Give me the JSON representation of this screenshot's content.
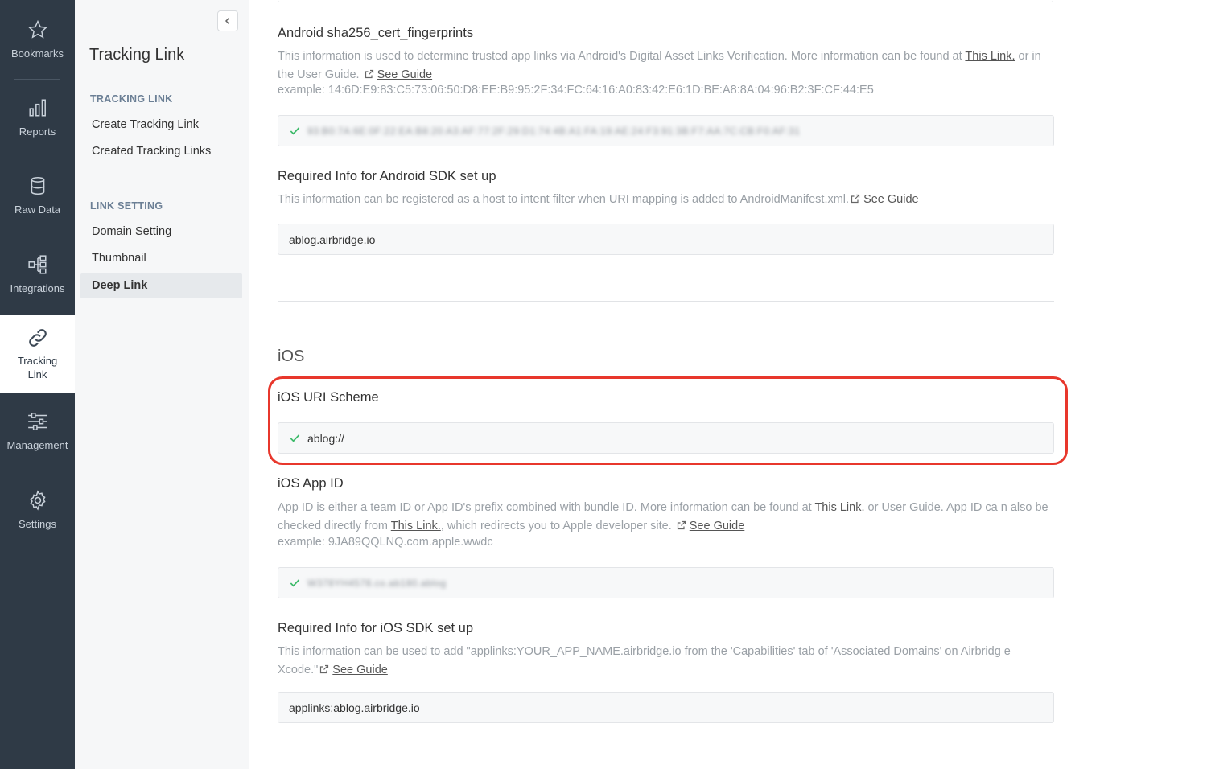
{
  "rail": {
    "items": [
      {
        "label": "Bookmarks",
        "icon": "star-icon"
      },
      {
        "label": "Reports",
        "icon": "bar-chart-icon"
      },
      {
        "label": "Raw Data",
        "icon": "database-icon"
      },
      {
        "label": "Integrations",
        "icon": "integrations-icon"
      },
      {
        "label": "Tracking\nLink",
        "icon": "link-icon"
      },
      {
        "label": "Management",
        "icon": "sliders-icon"
      },
      {
        "label": "Settings",
        "icon": "gear-icon"
      }
    ]
  },
  "subnav": {
    "title": "Tracking Link",
    "sections": [
      {
        "header": "TRACKING LINK",
        "items": [
          "Create Tracking Link",
          "Created Tracking Links"
        ]
      },
      {
        "header": "LINK SETTING",
        "items": [
          "Domain Setting",
          "Thumbnail",
          "Deep Link"
        ]
      }
    ],
    "active_item": "Deep Link"
  },
  "android_fingerprints": {
    "title": "Android sha256_cert_fingerprints",
    "desc_part1": "This information is used to determine trusted app links via Android's Digital Asset Links Verification. More information can be found at ",
    "link1": "This Link.",
    "desc_part2": " or in the User Guide.",
    "guide": "See Guide",
    "example": "example: 14:6D:E9:83:C5:73:06:50:D8:EE:B9:95:2F:34:FC:64:16:A0:83:42:E6:1D:BE:A8:8A:04:96:B2:3F:CF:44:E5",
    "value": "93:B0:7A:6E:0F:22:EA:B8:20:A3:AF:77:2F:29:D1:74:4B:A1:FA:19:AE:24:F3:91:3B:F7:AA:7C:CB:F0:AF:31"
  },
  "android_sdk": {
    "title": "Required Info for Android SDK set up",
    "desc": "This information can be registered as a host to intent filter when URI mapping is added to AndroidManifest.xml.",
    "guide": "See Guide",
    "value": "ablog.airbridge.io"
  },
  "ios": {
    "section_title": "iOS",
    "uri_scheme": {
      "title": "iOS URI Scheme",
      "value": "ablog://"
    },
    "app_id": {
      "title": "iOS App ID",
      "desc_part1": "App ID is either a team ID or App ID's prefix combined with bundle ID. More information can be found at ",
      "link1": "This Link.",
      "desc_part2": " or User Guide. App ID ca n also be checked directly from ",
      "link2": "This Link.",
      "desc_part3": ", which redirects you to Apple developer site.",
      "guide": "See Guide",
      "example": "example: 9JA89QQLNQ.com.apple.wwdc",
      "value": "W378YH4578.co.ab180.ablog"
    },
    "sdk": {
      "title": "Required Info for iOS SDK set up",
      "desc": "This information can be used to add \"applinks:YOUR_APP_NAME.airbridge.io from the 'Capabilities' tab of 'Associated Domains' on Airbridg e Xcode.\"",
      "guide": "See Guide",
      "value": "applinks:ablog.airbridge.io"
    }
  },
  "colors": {
    "rail_bg": "#2f3a46",
    "highlight": "#e8372c",
    "check": "#3dba6a"
  }
}
